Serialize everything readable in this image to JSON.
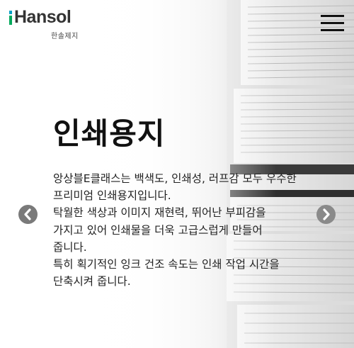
{
  "brand": {
    "logo_text": "Hansol",
    "logo_subtext": "한솔제지"
  },
  "header": {
    "menu_icon": "hamburger-menu-icon"
  },
  "slide": {
    "title": "인쇄용지",
    "description_lines": [
      "앙상블E클래스는 백색도, 인쇄성, 러프감 모두 우수한 프리미엄 인쇄용지입니다.",
      "탁월한 색상과 이미지 재현력, 뛰어난 부피감을 가지고 있어 인쇄물을 더욱 고급스럽게 만들어 줍니다.",
      "특히 획기적인 잉크 건조 속도는 인쇄 작업 시간을 단축시켜 줍니다."
    ]
  },
  "carousel": {
    "prev_icon": "chevron-left-icon",
    "next_icon": "chevron-right-icon"
  },
  "colors": {
    "logo_blue": "#00a0c6",
    "logo_green": "#00a95c",
    "text": "#111111",
    "arrow_bg": "#7a7a7a"
  }
}
